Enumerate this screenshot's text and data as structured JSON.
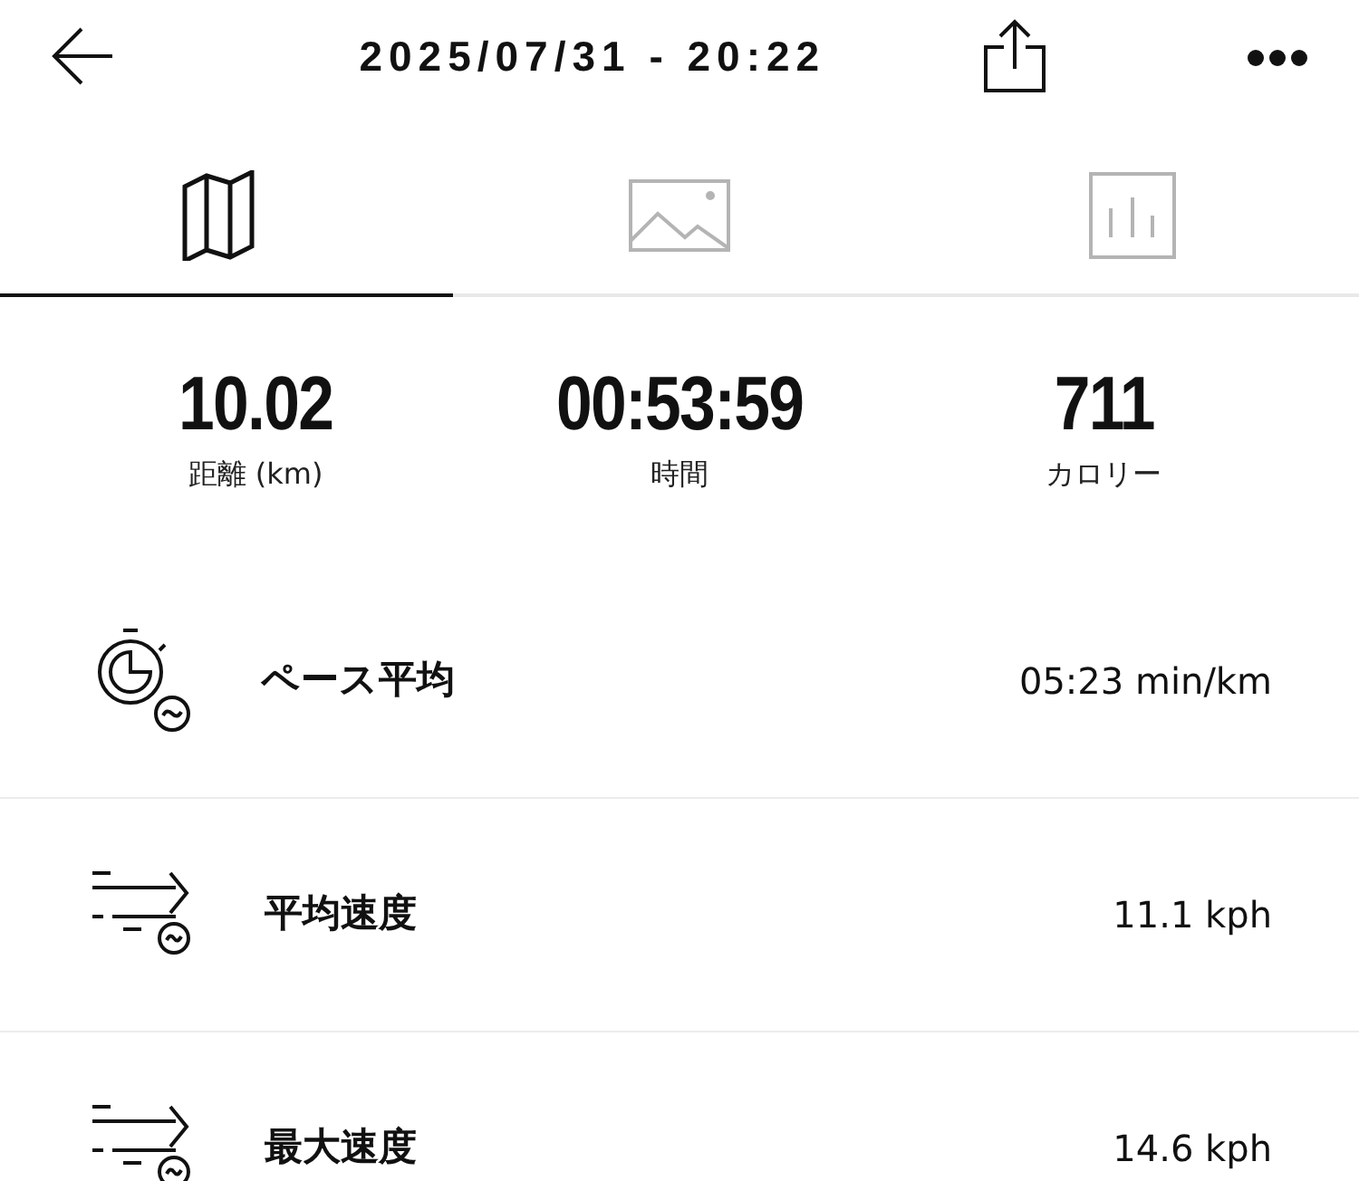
{
  "header": {
    "title": "2025/07/31 - 20:22"
  },
  "tabs": [
    {
      "kind": "map",
      "selected": true
    },
    {
      "kind": "photo",
      "selected": false
    },
    {
      "kind": "chart",
      "selected": false
    }
  ],
  "stats": [
    {
      "value": "10.02",
      "label": "距離 (km)"
    },
    {
      "value": "00:53:59",
      "label": "時間"
    },
    {
      "value": "711",
      "label": "カロリー"
    }
  ],
  "metrics": [
    {
      "kind": "pace",
      "label": "ペース平均",
      "value": "05:23 min/km"
    },
    {
      "kind": "speed",
      "label": "平均速度",
      "value": "11.1 kph"
    },
    {
      "kind": "speed",
      "label": "最大速度",
      "value": "14.6 kph"
    }
  ]
}
